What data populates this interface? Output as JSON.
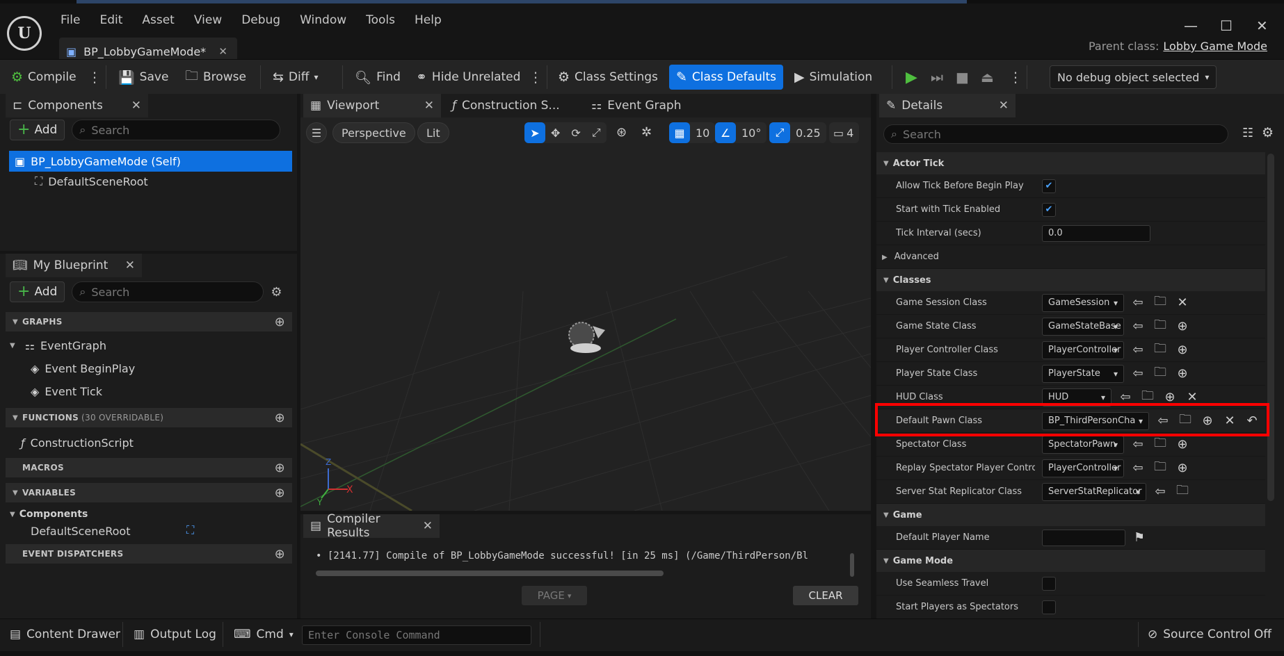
{
  "menu": {
    "items": [
      "File",
      "Edit",
      "Asset",
      "View",
      "Debug",
      "Window",
      "Tools",
      "Help"
    ]
  },
  "document_tab": {
    "label": "BP_LobbyGameMode*"
  },
  "parent_class": {
    "label": "Parent class:",
    "value": "Lobby Game Mode"
  },
  "toolbar": {
    "compile": "Compile",
    "save": "Save",
    "browse": "Browse",
    "diff": "Diff",
    "find": "Find",
    "hide_unrelated": "Hide Unrelated",
    "class_settings": "Class Settings",
    "class_defaults": "Class Defaults",
    "simulation": "Simulation",
    "debug_object": "No debug object selected"
  },
  "components": {
    "tab": "Components",
    "add": "Add",
    "search_placeholder": "Search",
    "items": [
      "BP_LobbyGameMode (Self)",
      "DefaultSceneRoot"
    ]
  },
  "my_blueprint": {
    "tab": "My Blueprint",
    "add": "Add",
    "search_placeholder": "Search",
    "graphs": "GRAPHS",
    "event_graph": "EventGraph",
    "event_beginplay": "Event BeginPlay",
    "event_tick": "Event Tick",
    "functions": "FUNCTIONS",
    "functions_count": "(30 OVERRIDABLE)",
    "construction_script": "ConstructionScript",
    "macros": "MACROS",
    "variables": "VARIABLES",
    "var_category": "Components",
    "var_item": "DefaultSceneRoot",
    "event_dispatchers": "EVENT DISPATCHERS"
  },
  "viewport": {
    "tabs": [
      "Viewport",
      "Construction S...",
      "Event Graph"
    ],
    "perspective": "Perspective",
    "lit": "Lit",
    "grid": "10",
    "angle": "10°",
    "scale": "0.25",
    "camera": "4"
  },
  "compiler": {
    "tab": "Compiler Results",
    "message": "[2141.77] Compile of BP_LobbyGameMode successful! [in 25 ms] (/Game/ThirdPerson/Bl",
    "page": "PAGE",
    "clear": "CLEAR"
  },
  "details": {
    "tab": "Details",
    "search_placeholder": "Search",
    "actor_tick": "Actor Tick",
    "allow_tick": "Allow Tick Before Begin Play",
    "start_tick": "Start with Tick Enabled",
    "tick_interval": "Tick Interval (secs)",
    "tick_interval_value": "0.0",
    "advanced": "Advanced",
    "classes": "Classes",
    "game_session_label": "Game Session Class",
    "game_session_value": "GameSession",
    "game_state_label": "Game State Class",
    "game_state_value": "GameStateBase",
    "player_controller_label": "Player Controller Class",
    "player_controller_value": "PlayerController",
    "player_state_label": "Player State Class",
    "player_state_value": "PlayerState",
    "hud_label": "HUD Class",
    "hud_value": "HUD",
    "default_pawn_label": "Default Pawn Class",
    "default_pawn_value": "BP_ThirdPersonCha",
    "spectator_label": "Spectator Class",
    "spectator_value": "SpectatorPawn",
    "replay_label": "Replay Spectator Player Controll...",
    "replay_value": "PlayerController",
    "server_stat_label": "Server Stat Replicator Class",
    "server_stat_value": "ServerStatReplicator",
    "game": "Game",
    "default_player_name": "Default Player Name",
    "game_mode": "Game Mode",
    "seamless_travel": "Use Seamless Travel",
    "start_spectators": "Start Players as Spectators"
  },
  "statusbar": {
    "content_drawer": "Content Drawer",
    "output_log": "Output Log",
    "cmd": "Cmd",
    "console_placeholder": "Enter Console Command",
    "source_control": "Source Control Off"
  },
  "colors": {
    "accent": "#0e70e0",
    "highlight": "#ff0000",
    "play": "#4fbf3f"
  }
}
